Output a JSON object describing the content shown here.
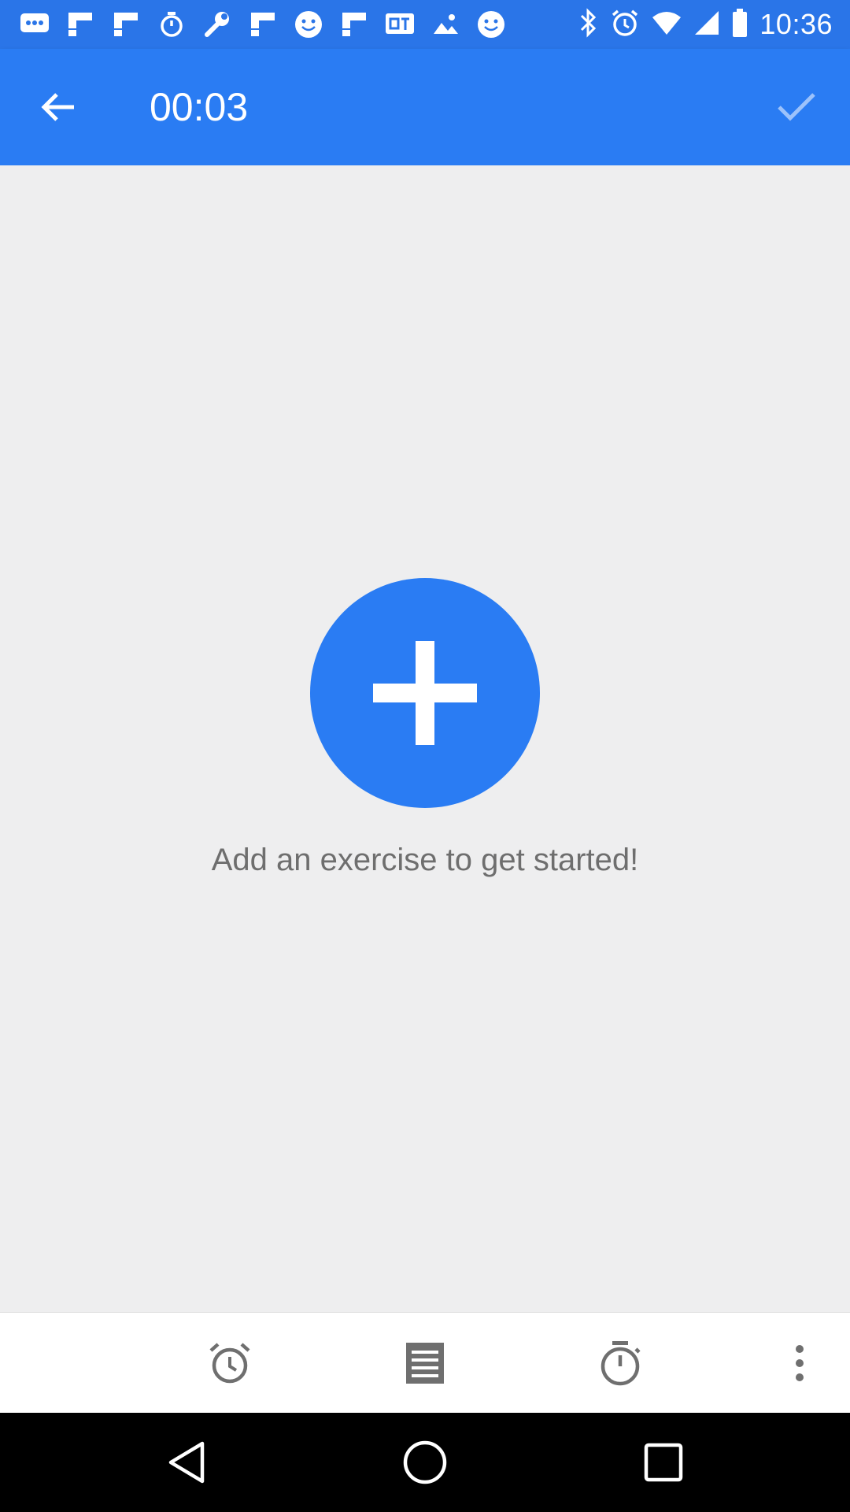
{
  "status_bar": {
    "time": "10:36",
    "icons": [
      "messaging-icon",
      "flipboard-icon",
      "flipboard-icon",
      "stopwatch-icon",
      "wrench-icon",
      "flipboard-icon",
      "smiley-icon",
      "flipboard-icon",
      "qt-icon",
      "photo-icon",
      "smiley-icon"
    ],
    "right_icons": [
      "bluetooth-icon",
      "alarm-icon",
      "wifi-icon",
      "signal-icon",
      "battery-icon"
    ]
  },
  "app_bar": {
    "title": "00:03",
    "back_icon": "arrow-back-icon",
    "confirm_icon": "check-icon",
    "color": "#2a7cf3"
  },
  "main": {
    "add_icon": "plus-icon",
    "empty_message": "Add an exercise to get started!"
  },
  "bottom_toolbar": {
    "items": [
      "alarm-clock-icon",
      "notes-icon",
      "stopwatch-icon",
      "more-vert-icon"
    ]
  },
  "nav_bar": {
    "items": [
      "back-triangle-icon",
      "home-circle-icon",
      "recents-square-icon"
    ]
  },
  "colors": {
    "accent": "#2a7cf3",
    "background": "#eeeeef",
    "icon_gray": "#6f6f6f"
  }
}
